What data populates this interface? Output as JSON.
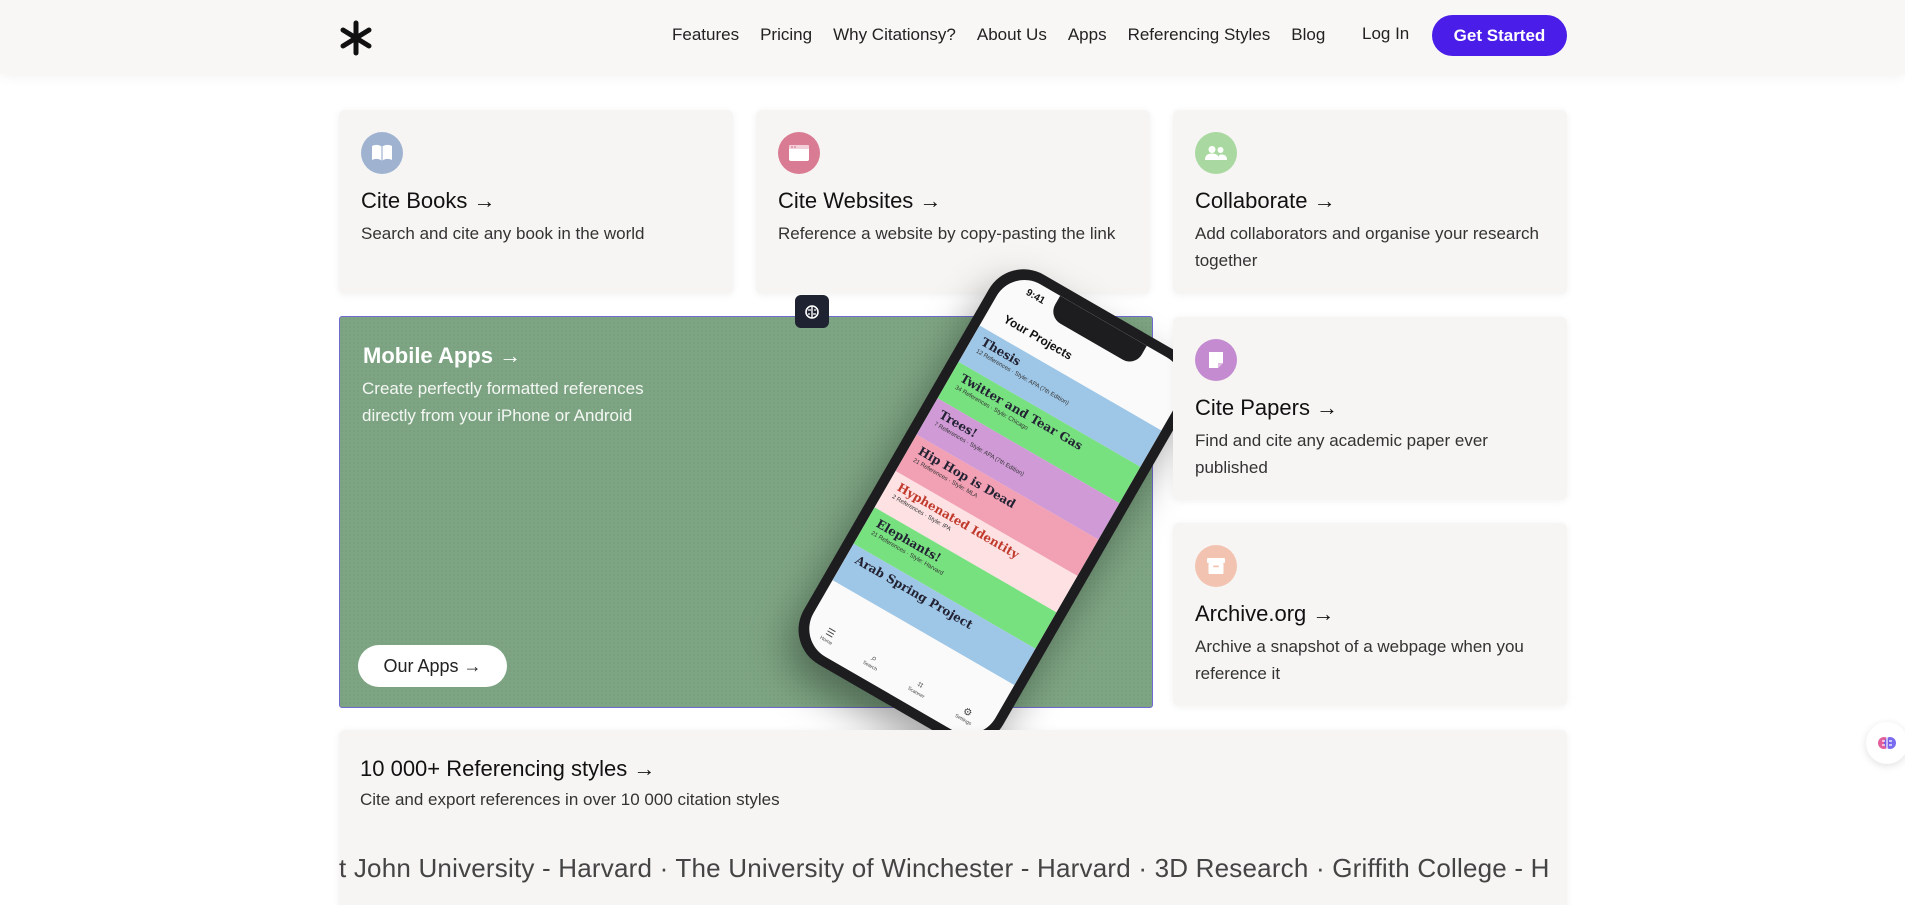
{
  "nav": {
    "links": [
      "Features",
      "Pricing",
      "Why Citationsy?",
      "About Us",
      "Apps",
      "Referencing Styles",
      "Blog"
    ],
    "login": "Log In",
    "cta": "Get Started"
  },
  "cards": {
    "books": {
      "title": "Cite Books →",
      "desc": "Search and cite any book in the world",
      "icon": "book-icon",
      "color": "#9fb3d1"
    },
    "websites": {
      "title": "Cite Websites →",
      "desc": "Reference a website by copy-pasting the link",
      "icon": "browser-window-icon",
      "color": "#d97b93"
    },
    "collaborate": {
      "title": "Collaborate →",
      "desc": "Add collaborators and organise your research together",
      "icon": "people-icon",
      "color": "#a9d9a0"
    },
    "papers": {
      "title": "Cite Papers →",
      "desc": "Find and cite any academic paper ever published",
      "icon": "paper-icon",
      "color": "#c58bd0"
    },
    "archive": {
      "title": "Archive.org →",
      "desc": "Archive a snapshot of a webpage when you reference it",
      "icon": "archive-box-icon",
      "color": "#f3c3b2"
    }
  },
  "apps": {
    "title": "Mobile Apps →",
    "desc": "Create perfectly formatted references directly from your iPhone or Android",
    "button": "Our Apps →",
    "phone": {
      "time": "9:41",
      "heading": "Your Projects",
      "projects": [
        {
          "name": "Thesis",
          "meta": "12 References · Style: APA (7th Edition)",
          "color": "#9ec6e6"
        },
        {
          "name": "Twitter and Tear Gas",
          "meta": "34 References · Style: Chicago",
          "color": "#77e07f"
        },
        {
          "name": "Trees!",
          "meta": "7 References · Style: APA (7th Edition)",
          "color": "#cf9ad6"
        },
        {
          "name": "Hip Hop is Dead",
          "meta": "21 References · Style: MLA",
          "color": "#f2a0b4"
        },
        {
          "name": "Hyphenated Identity",
          "meta": "2 References · Style: IPA",
          "color": "#fde1e3"
        },
        {
          "name": "Elephants!",
          "meta": "21 References · Style: Harvard",
          "color": "#77e07f"
        },
        {
          "name": "Arab Spring Project",
          "meta": "",
          "color": "#9ec6e6"
        }
      ],
      "tabs": [
        "Home",
        "Search",
        "Scanner",
        "Settings"
      ]
    }
  },
  "styles": {
    "title": "10 000+ Referencing styles →",
    "desc": "Cite and export references in over 10 000 citation styles",
    "marquee": "t John University - Harvard · The University of Winchester - Harvard · 3D Research · Griffith College - H"
  }
}
